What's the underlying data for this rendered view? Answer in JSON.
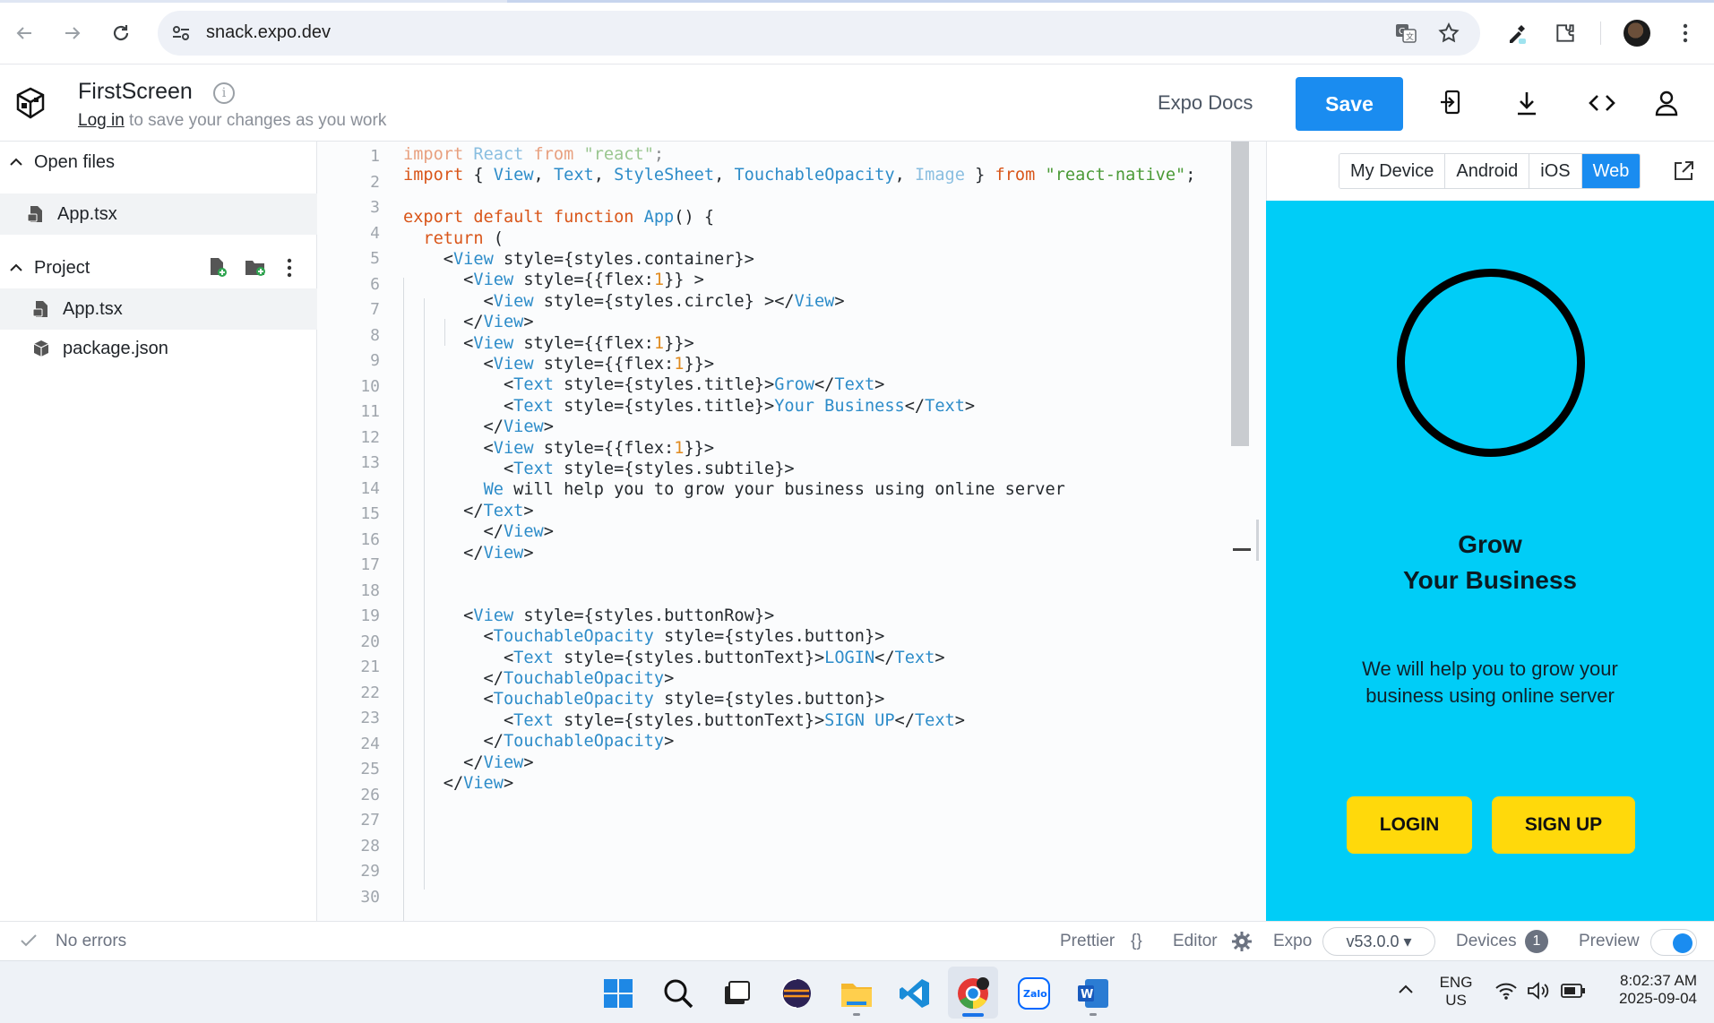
{
  "browser": {
    "url": "snack.expo.dev"
  },
  "header": {
    "title": "FirstScreen",
    "info_symbol": "i",
    "login_link": "Log in",
    "login_suffix": " to save your changes as you work",
    "expo_docs": "Expo Docs",
    "save_label": "Save"
  },
  "sidebar": {
    "open_files_label": "Open files",
    "open_files": [
      {
        "name": "App.tsx"
      }
    ],
    "project_label": "Project",
    "project_files": [
      {
        "name": "App.tsx"
      },
      {
        "name": "package.json"
      }
    ]
  },
  "editor": {
    "line_numbers": [
      "1",
      "2",
      "3",
      "4",
      "5",
      "6",
      "7",
      "8",
      "9",
      "10",
      "11",
      "12",
      "13",
      "14",
      "15",
      "16",
      "17",
      "18",
      "19",
      "20",
      "21",
      "22",
      "23",
      "24",
      "25",
      "26",
      "27",
      "28",
      "29",
      "30"
    ]
  },
  "preview": {
    "tabs": [
      "My Device",
      "Android",
      "iOS",
      "Web"
    ],
    "selected_tab": "Web",
    "title_line1": "Grow",
    "title_line2": "Your Business",
    "subtitle": "We will help you to grow your business using online server",
    "login_button": "LOGIN",
    "signup_button": "SIGN UP",
    "background_color": "#00cdf7",
    "button_color": "#ffd90b"
  },
  "status": {
    "errors": "No errors",
    "prettier": "Prettier",
    "prettier_glyph": "{}",
    "editor": "Editor",
    "expo": "Expo",
    "version": "v53.0.0 ▾",
    "devices": "Devices",
    "devices_count": "1",
    "preview": "Preview",
    "preview_enabled": true
  },
  "taskbar": {
    "lang_line1": "ENG",
    "lang_line2": "US",
    "time": "8:02:37 AM",
    "date": "2025-09-04",
    "zalo_label": "Zalo",
    "word_label": "W"
  },
  "colors": {
    "accent": "#1a8cf0"
  }
}
